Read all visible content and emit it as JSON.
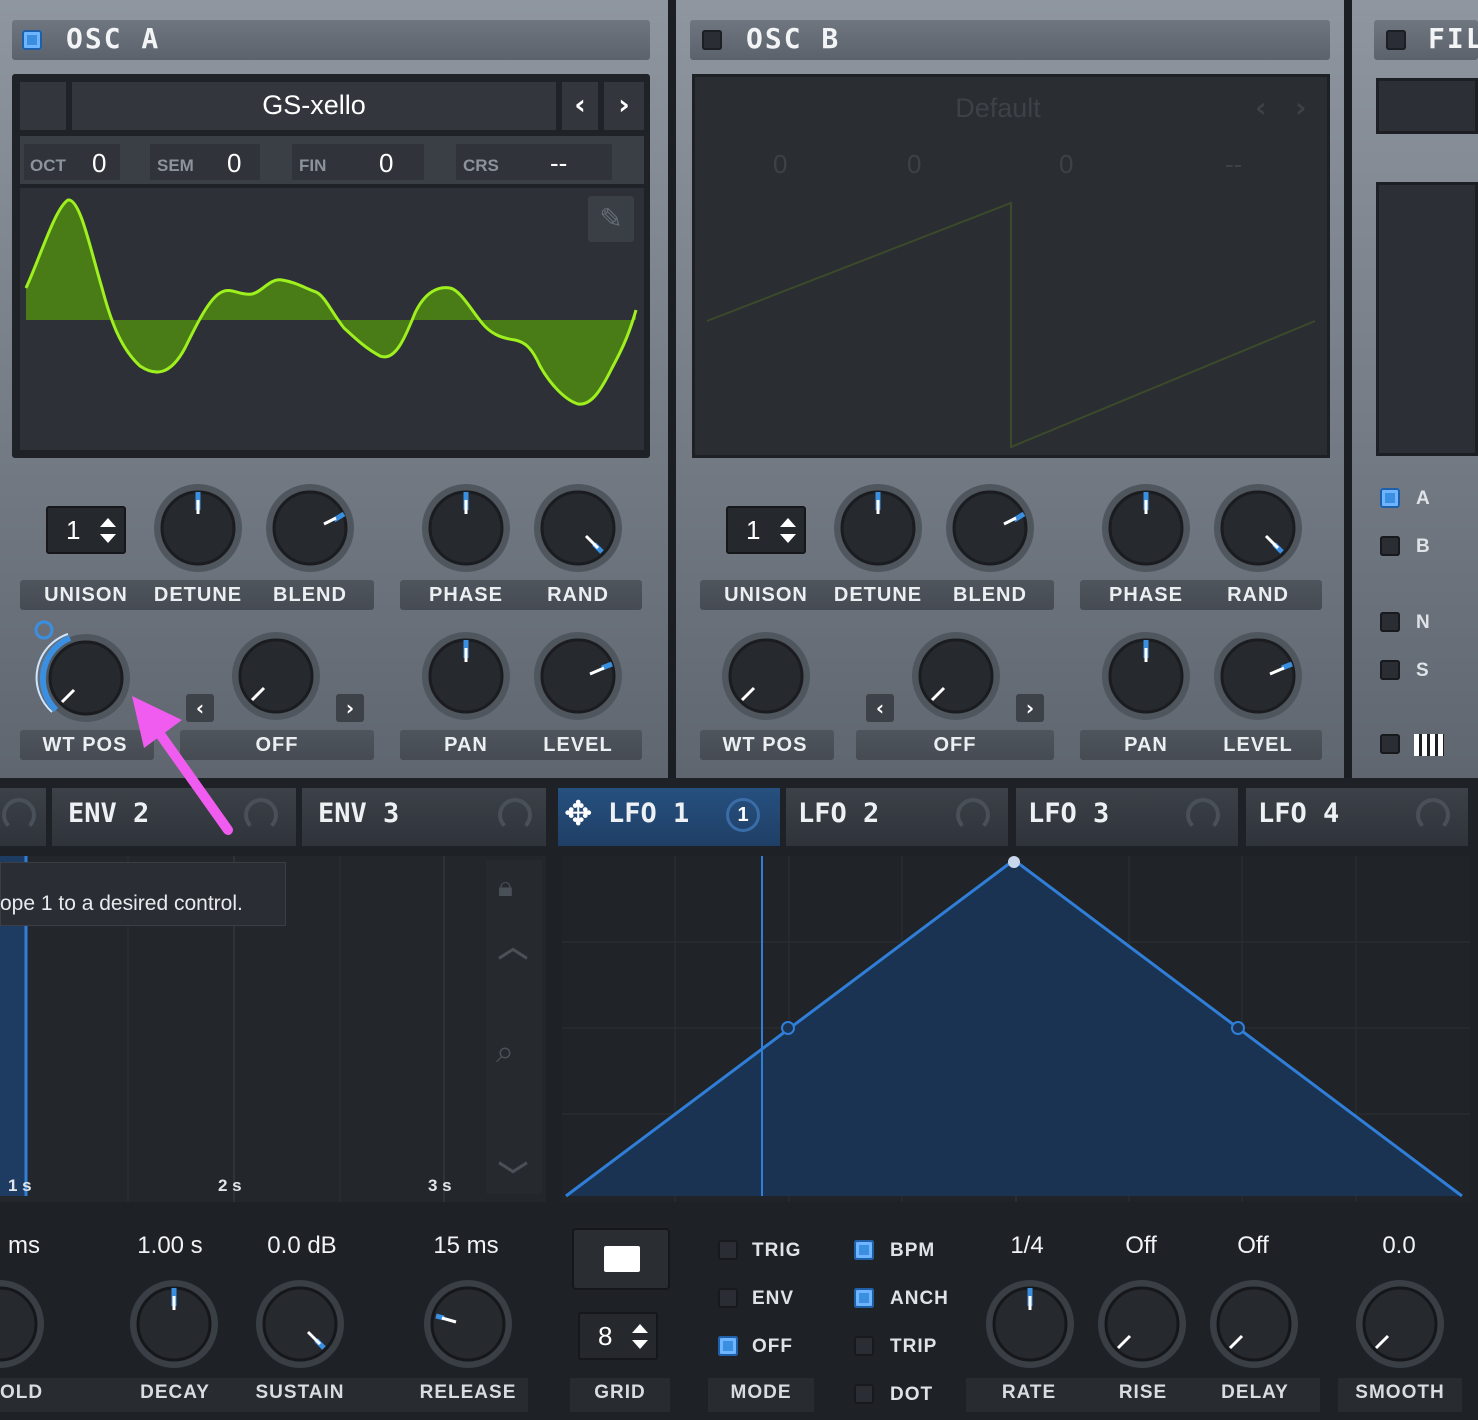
{
  "osc_a": {
    "title": "OSC A",
    "enabled": true,
    "wavetable_name": "GS-xello",
    "params": [
      {
        "label": "OCT",
        "value": "0"
      },
      {
        "label": "SEM",
        "value": "0"
      },
      {
        "label": "FIN",
        "value": "0"
      },
      {
        "label": "CRS",
        "value": "--"
      }
    ],
    "unison_value": "1",
    "knob_labels": {
      "unison": "UNISON",
      "detune": "DETUNE",
      "blend": "BLEND",
      "phase": "PHASE",
      "rand": "RAND",
      "wt_pos": "WT POS",
      "off": "OFF",
      "pan": "PAN",
      "level": "LEVEL"
    }
  },
  "osc_b": {
    "title": "OSC B",
    "enabled": false,
    "wavetable_name": "Default",
    "params": [
      {
        "label": "",
        "value": "0"
      },
      {
        "label": "",
        "value": "0"
      },
      {
        "label": "",
        "value": "0"
      },
      {
        "label": "",
        "value": "--"
      }
    ],
    "unison_value": "1",
    "knob_labels": {
      "unison": "UNISON",
      "detune": "DETUNE",
      "blend": "BLEND",
      "phase": "PHASE",
      "rand": "RAND",
      "wt_pos": "WT POS",
      "off": "OFF",
      "pan": "PAN",
      "level": "LEVEL"
    }
  },
  "filter": {
    "title": "FILT",
    "routes": [
      {
        "label": "A",
        "on": true
      },
      {
        "label": "B",
        "on": false
      },
      {
        "label": "N",
        "on": false
      },
      {
        "label": "S",
        "on": false
      }
    ]
  },
  "mod_tabs": [
    {
      "label": "ENV 2",
      "badge": ""
    },
    {
      "label": "ENV 3",
      "badge": ""
    },
    {
      "label": "LFO 1",
      "badge": "1"
    },
    {
      "label": "LFO 2",
      "badge": ""
    },
    {
      "label": "LFO 3",
      "badge": ""
    },
    {
      "label": "LFO 4",
      "badge": ""
    }
  ],
  "envelope": {
    "tooltip": "ope 1 to a desired control.",
    "time_marks": [
      "1 s",
      "2 s",
      "3 s"
    ],
    "values": [
      "ms",
      "1.00 s",
      "0.0 dB",
      "15 ms"
    ],
    "labels": [
      "OLD",
      "DECAY",
      "SUSTAIN",
      "RELEASE"
    ]
  },
  "lfo": {
    "switches_left": [
      {
        "label": "TRIG",
        "on": false
      },
      {
        "label": "ENV",
        "on": false
      },
      {
        "label": "OFF",
        "on": true
      }
    ],
    "switches_right": [
      {
        "label": "BPM",
        "on": true
      },
      {
        "label": "ANCH",
        "on": true
      },
      {
        "label": "TRIP",
        "on": false
      },
      {
        "label": "DOT",
        "on": false
      }
    ],
    "grid_value": "8",
    "grid_label": "GRID",
    "mode_label": "MODE",
    "knob_values": [
      "1/4",
      "Off",
      "Off",
      "0.0"
    ],
    "knob_labels": [
      "RATE",
      "RISE",
      "DELAY",
      "SMOOTH"
    ]
  },
  "colors": {
    "accent": "#3b8fe0",
    "waveform": "#8ee21c",
    "lfo_line": "#2f7fd8",
    "annotation_arrow": "#f15cf0"
  }
}
